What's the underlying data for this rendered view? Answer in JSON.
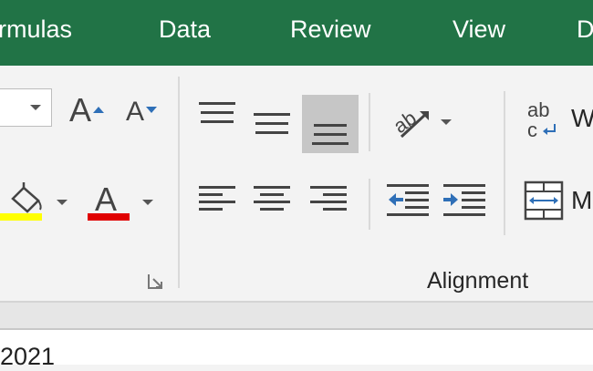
{
  "ribbon_tabs": {
    "formulas": "rmulas",
    "data": "Data",
    "review": "Review",
    "view": "View",
    "next": "D"
  },
  "font_group": {
    "font_size_value": "",
    "increase_font_icon": "A",
    "decrease_font_icon": "A",
    "font_color_icon": "A",
    "fill_color": "#ffff00",
    "font_color": "#e00000"
  },
  "alignment_group": {
    "label": "Alignment",
    "wrap_text_icon_top": "ab",
    "wrap_text_icon_bottom": "c",
    "wrap_text_label": "W",
    "merge_label": "M"
  },
  "theme": {
    "tab_bar_color": "#217346",
    "selected_button_color": "#c6c6c6",
    "indent_icon_color": "#2e6fb7"
  },
  "sheet": {
    "visible_cell_text": "2021"
  }
}
